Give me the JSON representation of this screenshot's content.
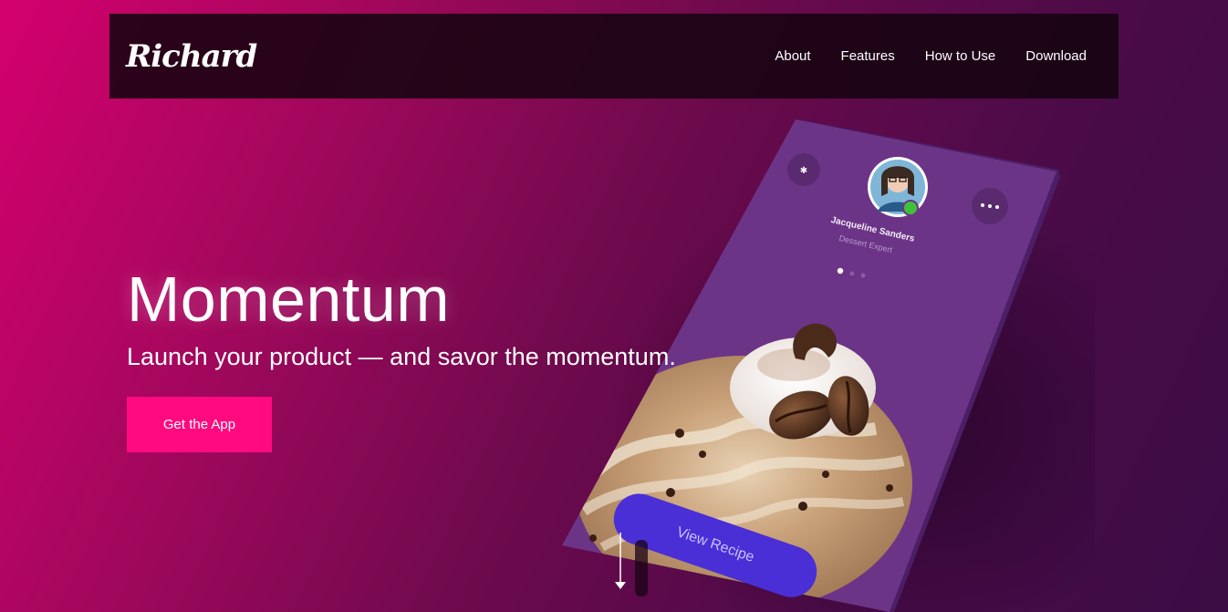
{
  "brand": {
    "name": "Richard"
  },
  "nav": {
    "items": [
      "About",
      "Features",
      "How to Use",
      "Download"
    ]
  },
  "hero": {
    "title": "Momentum",
    "subtitle": "Launch your product — and savor the momentum.",
    "cta_label": "Get the App"
  },
  "phone": {
    "profile_name": "Jacqueline Sanders",
    "profile_role": "Dessert Expert",
    "button_label": "View Recipe",
    "carousel_dots": 3,
    "carousel_active": 1
  },
  "colors": {
    "accent": "#ff0a7f",
    "phone_screen": "#6c3487",
    "recipe_button": "#4a2fd6",
    "status_online": "#3fc23a"
  },
  "icons": [
    "star-icon",
    "more-options-icon",
    "scroll-down-arrow-icon"
  ]
}
